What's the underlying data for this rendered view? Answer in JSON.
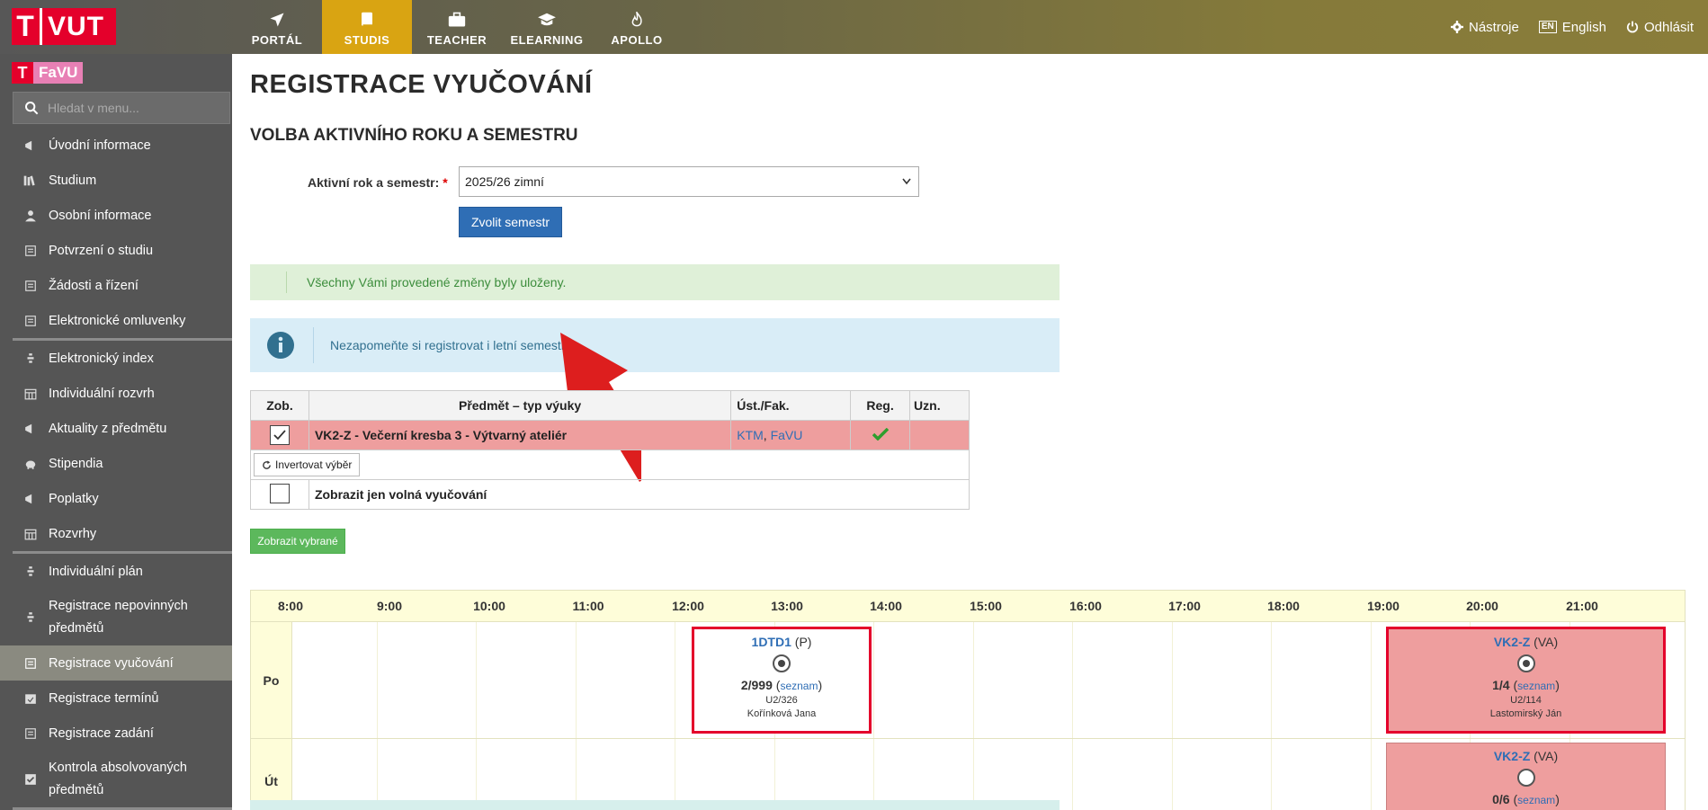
{
  "brand": {
    "logo_text": "VUT",
    "logo_mark": "T"
  },
  "nav": [
    {
      "label": "PORTÁL",
      "icon": "paper-plane-icon"
    },
    {
      "label": "STUDIS",
      "icon": "book-icon"
    },
    {
      "label": "TEACHER",
      "icon": "briefcase-icon"
    },
    {
      "label": "ELEARNING",
      "icon": "graduation-cap-icon"
    },
    {
      "label": "APOLLO",
      "icon": "flame-icon"
    }
  ],
  "top_right": {
    "tools": "Nástroje",
    "language": "English",
    "language_badge": "EN",
    "logout": "Odhlásit"
  },
  "faculty": {
    "mark": "T",
    "name": "FaVU"
  },
  "sidebar": {
    "search_placeholder": "Hledat v menu...",
    "group1": [
      "Úvodní informace",
      "Studium",
      "Osobní informace",
      "Potvrzení o studiu",
      "Žádosti a řízení",
      "Elektronické omluvenky"
    ],
    "group2": [
      "Elektronický index",
      "Individuální rozvrh",
      "Aktuality z předmětu",
      "Stipendia",
      "Poplatky",
      "Rozvrhy"
    ],
    "group3_a": "Individuální plán",
    "group3_b": "Registrace nepovinných předmětů",
    "group3_c": "Registrace vyučování",
    "group3_d": "Registrace termínů",
    "group3_e": "Registrace zadání",
    "group3_f": "Kontrola absolvovaných předmětů"
  },
  "page": {
    "title": "REGISTRACE VYUČOVÁNÍ",
    "section_title": "VOLBA AKTIVNÍHO ROKU A SEMESTRU",
    "semester_label": "Aktivní rok a semestr:",
    "required_mark": "*",
    "semester_value": "2025/26 zimní",
    "choose_button": "Zvolit semestr",
    "success_message": "Všechny Vámi provedené změny byly uloženy.",
    "info_message": "Nezapomeňte si registrovat i letní semestr."
  },
  "subjects_table": {
    "headers": {
      "show": "Zob.",
      "subject": "Předmět – typ výuky",
      "dept": "Úst./Fak.",
      "reg": "Reg.",
      "recog": "Uzn."
    },
    "row": {
      "name": "VK2-Z - Večerní kresba 3 - Výtvarný ateliér",
      "dept": "KTM",
      "sep": ", ",
      "faculty": "FaVU"
    },
    "invert_button": "Invertovat výběr",
    "free_only_label": "Zobrazit jen volná vyučování",
    "show_selected_button": "Zobrazit vybrané"
  },
  "timetable": {
    "hours": [
      "8:00",
      "9:00",
      "10:00",
      "11:00",
      "12:00",
      "13:00",
      "14:00",
      "15:00",
      "16:00",
      "17:00",
      "18:00",
      "19:00",
      "20:00",
      "21:00"
    ],
    "days": [
      "Po",
      "Út"
    ],
    "block1": {
      "code": "1DTD1",
      "type": " (P)",
      "count": "2/999",
      "list_open": " (",
      "list": "seznam",
      "list_close": ")",
      "room": "U2/326",
      "teacher": "Kořínková Jana"
    },
    "block2": {
      "code": "VK2-Z",
      "type": " (VA)",
      "count": "1/4",
      "list_open": " (",
      "list": "seznam",
      "list_close": ")",
      "room": "U2/114",
      "teacher": "Lastomirský Ján"
    },
    "block3": {
      "code": "VK2-Z",
      "type": " (VA)",
      "count": "0/6",
      "list_open": " (",
      "list": "seznam",
      "list_close": ")"
    }
  },
  "colors": {
    "accent_nav": "#d9a412",
    "brand_red": "#e4002b",
    "registered_row": "#ee9e9e",
    "arrow": "#dd1e1e"
  }
}
